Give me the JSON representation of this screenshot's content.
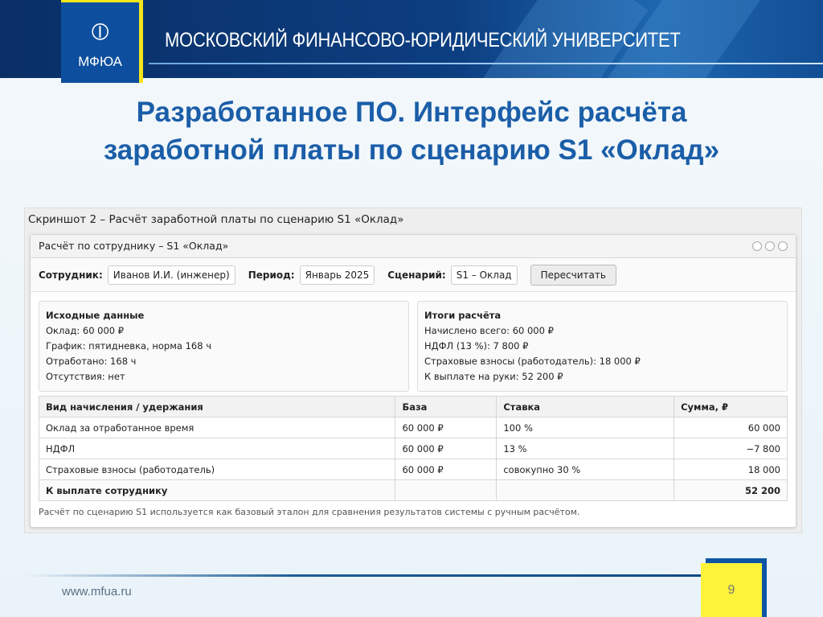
{
  "header": {
    "logo_abbr": "МФЮА",
    "university": "МОСКОВСКИЙ ФИНАНСОВО-ЮРИДИЧЕСКИЙ УНИВЕРСИТЕТ"
  },
  "slide": {
    "title_line1": "Разработанное ПО. Интерфейс расчёта",
    "title_line2": "заработной платы по сценарию S1 «Оклад»"
  },
  "screenshot": {
    "caption": "Скриншот 2 – Расчёт заработной платы по сценарию S1 «Оклад»",
    "window_title": "Расчёт по сотруднику – S1 «Оклад»",
    "toolbar": {
      "employee_label": "Сотрудник:",
      "employee_value": "Иванов И.И. (инженер)",
      "period_label": "Период:",
      "period_value": "Январь 2025",
      "scenario_label": "Сценарий:",
      "scenario_value": "S1 – Оклад",
      "recalc_label": "Пересчитать"
    },
    "input_panel": {
      "title": "Исходные данные",
      "lines": [
        "Оклад: 60 000 ₽",
        "График: пятидневка, норма 168 ч",
        "Отработано: 168 ч",
        "Отсутствия: нет"
      ]
    },
    "result_panel": {
      "title": "Итоги расчёта",
      "lines": [
        "Начислено всего: 60 000 ₽",
        "НДФЛ (13 %): 7 800 ₽",
        "Страховые взносы (работодатель): 18 000 ₽",
        "К выплате на руки: 52 200 ₽"
      ]
    },
    "table": {
      "headers": [
        "Вид начисления / удержания",
        "База",
        "Ставка",
        "Сумма, ₽"
      ],
      "rows": [
        [
          "Оклад за отработанное время",
          "60 000 ₽",
          "100 %",
          "60 000"
        ],
        [
          "НДФЛ",
          "60 000 ₽",
          "13 %",
          "−7 800"
        ],
        [
          "Страховые взносы (работодатель)",
          "60 000 ₽",
          "совокупно 30 %",
          "18 000"
        ],
        [
          "К выплате сотруднику",
          "",
          "",
          "52 200"
        ]
      ]
    },
    "note": "Расчёт по сценарию S1 используется как базовый эталон для сравнения результатов системы с ручным расчётом."
  },
  "footer": {
    "url": "www.mfua.ru",
    "page": "9"
  }
}
